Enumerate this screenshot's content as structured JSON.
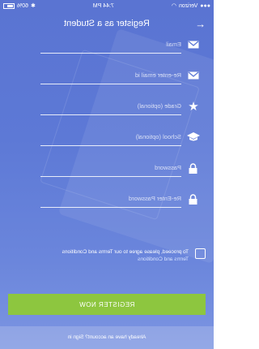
{
  "status": {
    "carrier": "Verizon",
    "time": "7:44 PM",
    "battery": "60%"
  },
  "header": {
    "title": "Register as a Student"
  },
  "fields": [
    {
      "icon": "envelope-icon",
      "placeholder": "Email"
    },
    {
      "icon": "envelope-icon",
      "placeholder": "Re-enter email id"
    },
    {
      "icon": "star-icon",
      "placeholder": "Grade (optional)"
    },
    {
      "icon": "graduation-cap-icon",
      "placeholder": "School (optional)"
    },
    {
      "icon": "lock-icon",
      "placeholder": "Password"
    },
    {
      "icon": "lock-icon",
      "placeholder": "Re-Enter Password"
    }
  ],
  "terms": {
    "text": "To proceed, please agree to our Terms and Conditions",
    "link": "Terms and Conditions"
  },
  "register_button": "REGISTER NOW",
  "signin": "Already have an account? Sign in"
}
